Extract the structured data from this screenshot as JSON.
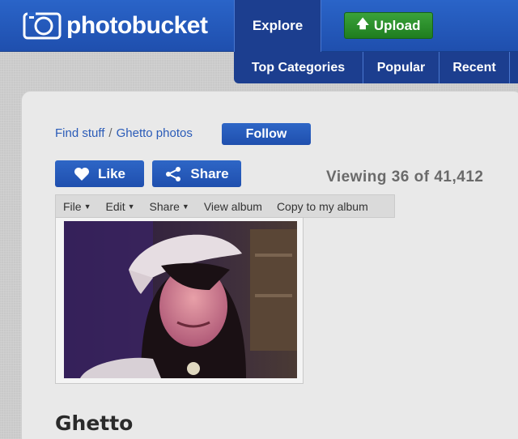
{
  "header": {
    "brand": "photobucket",
    "nav": {
      "explore_label": "Explore",
      "upload_label": "Upload"
    },
    "subnav": [
      "Top Categories",
      "Popular",
      "Recent"
    ]
  },
  "breadcrumb": {
    "items": [
      "Find stuff",
      "Ghetto photos"
    ],
    "separator": "/"
  },
  "follow_label": "Follow",
  "actions": {
    "like_label": "Like",
    "share_label": "Share"
  },
  "viewing_text": "Viewing 36 of 41,412",
  "menubar": {
    "file": "File",
    "edit": "Edit",
    "share": "Share",
    "view_album": "View album",
    "copy": "Copy to my album"
  },
  "photo_title": "Ghetto",
  "colors": {
    "brand_blue": "#1f4fae",
    "upload_green": "#2a8f2a"
  }
}
